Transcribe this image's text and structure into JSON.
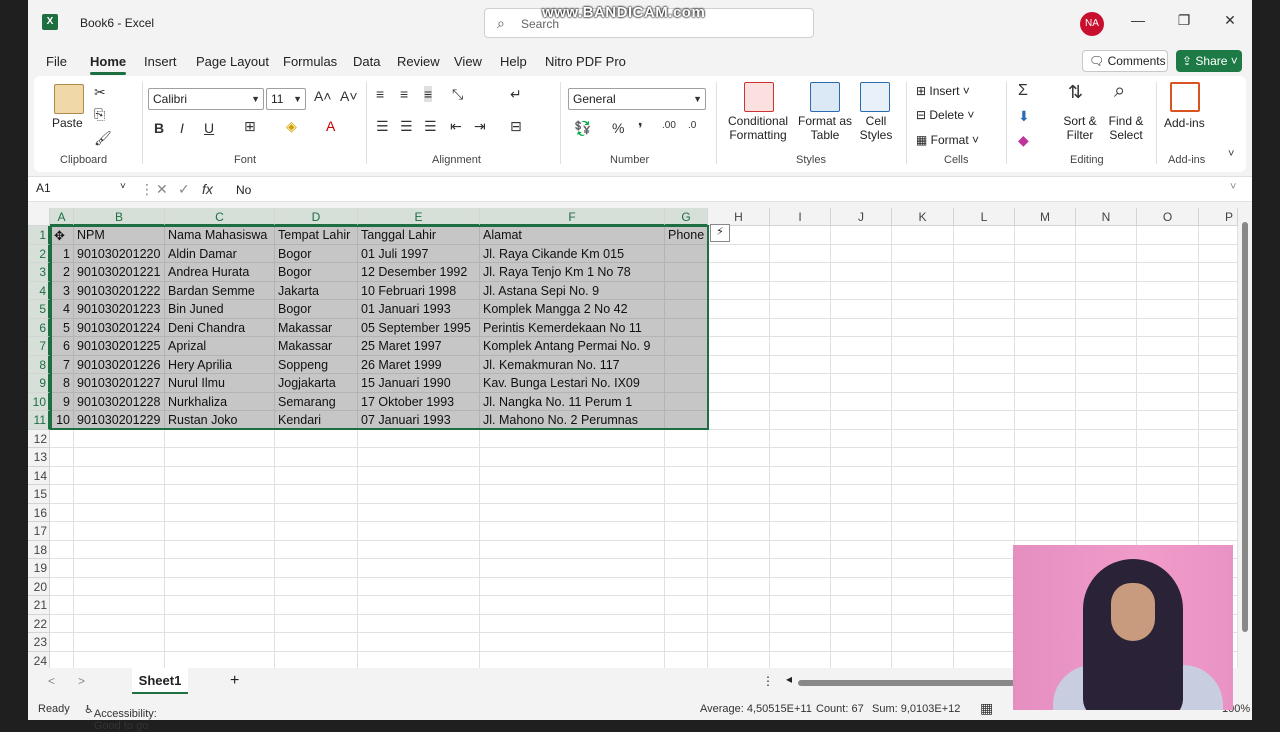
{
  "window": {
    "doc_title": "Book6  -  Excel",
    "search_placeholder": "Search",
    "watermark": "www.BANDICAM.com",
    "user_initials": "NA"
  },
  "menu": {
    "tabs": [
      "File",
      "Home",
      "Insert",
      "Page Layout",
      "Formulas",
      "Data",
      "Review",
      "View",
      "Help",
      "Nitro PDF Pro"
    ],
    "active": "Home",
    "comments_label": "Comments",
    "share_label": "Share"
  },
  "ribbon": {
    "clipboard": {
      "label": "Clipboard",
      "paste": "Paste"
    },
    "font": {
      "label": "Font",
      "name": "Calibri",
      "size": "11"
    },
    "alignment": {
      "label": "Alignment"
    },
    "number": {
      "label": "Number",
      "format": "General"
    },
    "styles": {
      "label": "Styles",
      "conditional": [
        "Conditional",
        "Formatting"
      ],
      "format_table": [
        "Format as",
        "Table"
      ],
      "cell_styles": [
        "Cell",
        "Styles"
      ]
    },
    "cells": {
      "label": "Cells",
      "insert": "Insert",
      "delete": "Delete",
      "format": "Format"
    },
    "editing": {
      "label": "Editing",
      "sort": [
        "Sort &",
        "Filter"
      ],
      "find": [
        "Find &",
        "Select"
      ]
    },
    "addins": {
      "label": "Add-ins",
      "button": "Add-ins"
    }
  },
  "formula_bar": {
    "name_box": "A1",
    "value": "No"
  },
  "columns": [
    "A",
    "B",
    "C",
    "D",
    "E",
    "F",
    "G",
    "H",
    "I",
    "J",
    "K",
    "L",
    "M",
    "N",
    "O",
    "P"
  ],
  "rows": [
    "1",
    "2",
    "3",
    "4",
    "5",
    "6",
    "7",
    "8",
    "9",
    "10",
    "11",
    "12",
    "13",
    "14",
    "15",
    "16",
    "17",
    "18",
    "19",
    "20",
    "21",
    "22",
    "23",
    "24"
  ],
  "table": {
    "header": [
      "",
      "NPM",
      "Nama Mahasiswa",
      "Tempat Lahir",
      "Tanggal Lahir",
      "Alamat",
      "Phone"
    ],
    "data": [
      [
        "1",
        "901030201220",
        "Aldin Damar",
        "Bogor",
        "01 Juli 1997",
        "Jl. Raya Cikande Km 015",
        ""
      ],
      [
        "2",
        "901030201221",
        "Andrea Hurata",
        "Bogor",
        "12 Desember 1992",
        "Jl. Raya Tenjo Km 1 No 78",
        ""
      ],
      [
        "3",
        "901030201222",
        "Bardan Semme",
        "Jakarta",
        "10 Februari 1998",
        "Jl. Astana Sepi No. 9",
        ""
      ],
      [
        "4",
        "901030201223",
        "Bin Juned",
        "Bogor",
        "01 Januari 1993",
        "Komplek Mangga 2 No 42",
        ""
      ],
      [
        "5",
        "901030201224",
        "Deni Chandra",
        "Makassar",
        "05 September 1995",
        "Perintis Kemerdekaan No 11",
        ""
      ],
      [
        "6",
        "901030201225",
        "Aprizal",
        "Makassar",
        "25 Maret 1997",
        "Komplek Antang Permai No. 9",
        ""
      ],
      [
        "7",
        "901030201226",
        "Hery Aprilia",
        "Soppeng",
        "26 Maret 1999",
        "Jl. Kemakmuran No. 117",
        ""
      ],
      [
        "8",
        "901030201227",
        "Nurul Ilmu",
        "Jogjakarta",
        "15 Januari 1990",
        "Kav. Bunga Lestari No. IX09",
        ""
      ],
      [
        "9",
        "901030201228",
        "Nurkhaliza",
        "Semarang",
        "17 Oktober 1993",
        "Jl. Nangka No. 11 Perum 1",
        ""
      ],
      [
        "10",
        "901030201229",
        "Rustan Joko",
        "Kendari",
        "07 Januari 1993",
        "Jl. Mahono No. 2 Perumnas",
        ""
      ]
    ]
  },
  "sheet": {
    "name": "Sheet1",
    "add": "+"
  },
  "status": {
    "ready": "Ready",
    "accessibility": "Accessibility: Good to go",
    "average": "Average: 4,50515E+11",
    "count": "Count: 67",
    "sum": "Sum: 9,0103E+12",
    "zoom": "100%"
  },
  "colors": {
    "accent": "#1d6f42",
    "selection": "#c6c6c6"
  }
}
